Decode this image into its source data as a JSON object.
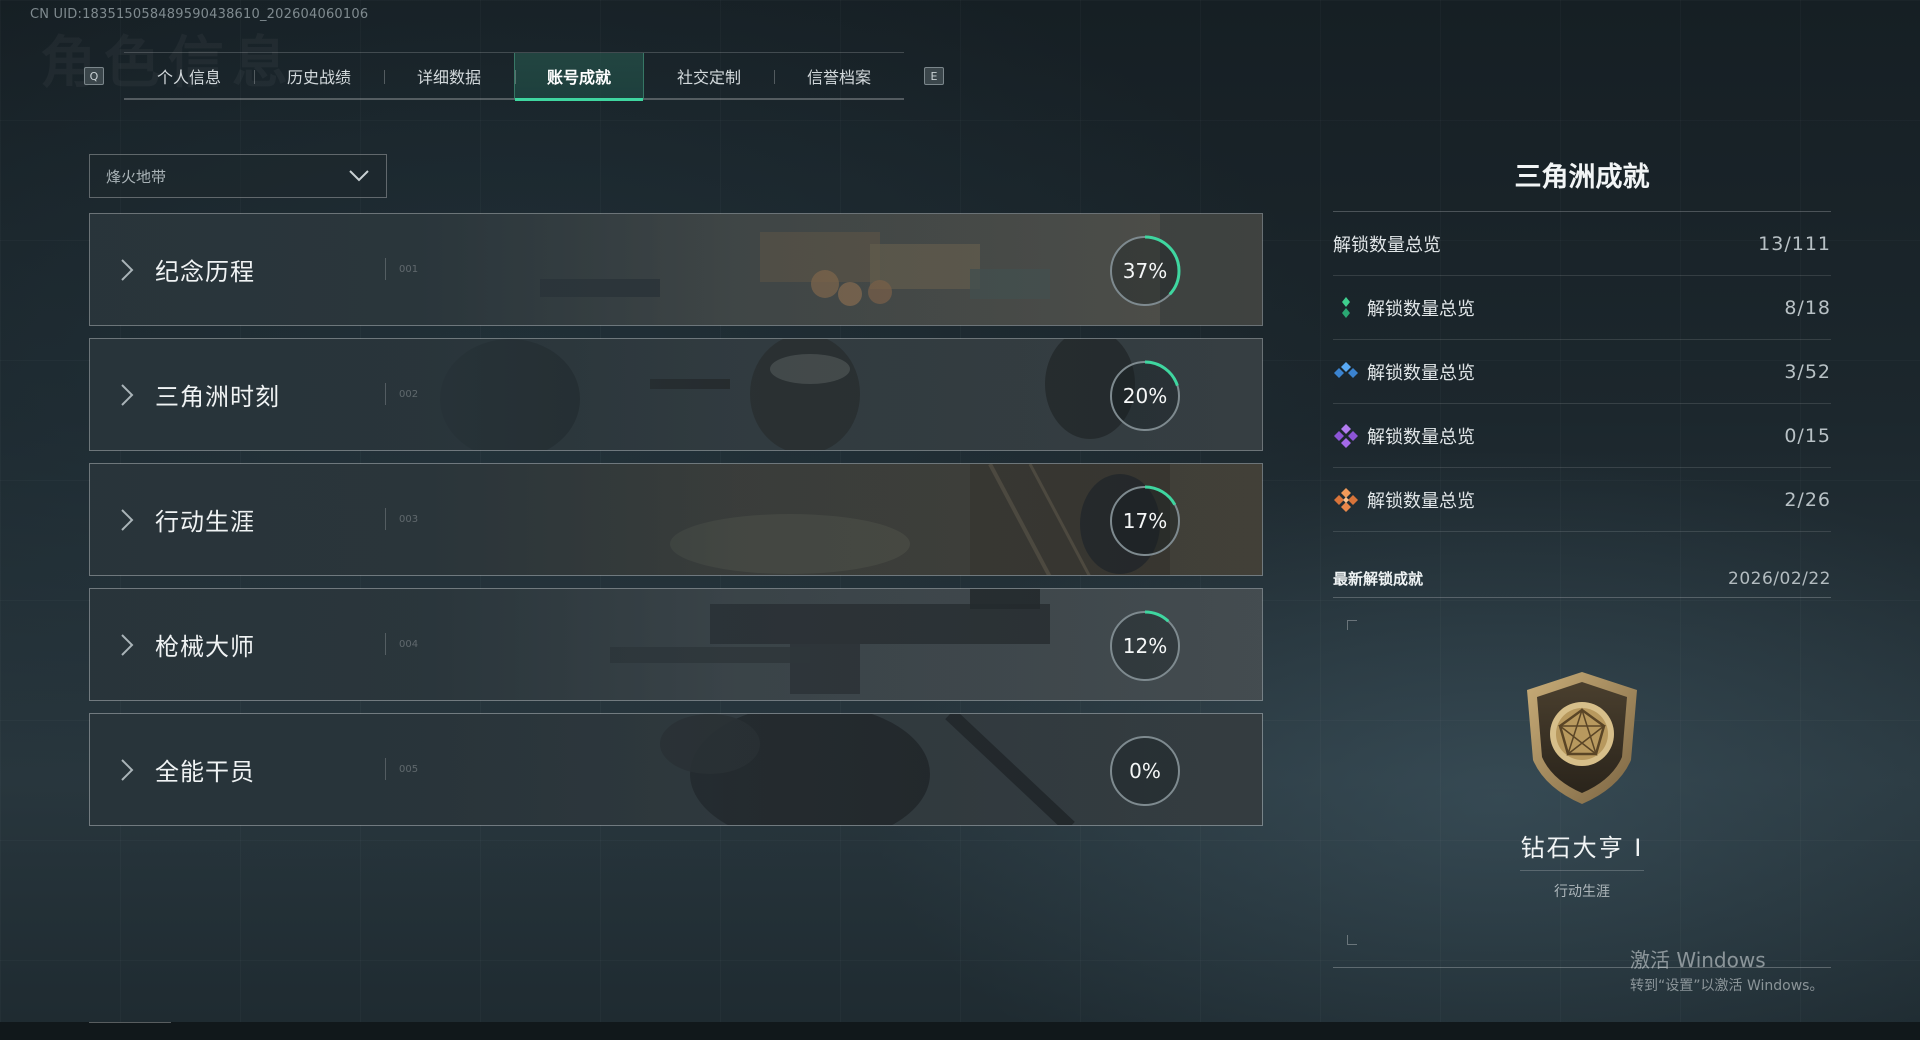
{
  "header": {
    "uid": "CN UID:1835150584895904386​10_202604060106",
    "tab_prev_key": "Q",
    "tab_next_key": "E",
    "tabs": [
      {
        "label": "个人信息",
        "active": false
      },
      {
        "label": "历史战绩",
        "active": false
      },
      {
        "label": "详细数据",
        "active": false
      },
      {
        "label": "账号成就",
        "active": true
      },
      {
        "label": "社交定制",
        "active": false
      },
      {
        "label": "信誉档案",
        "active": false
      }
    ]
  },
  "mode_select": {
    "value": "烽火地带"
  },
  "categories": [
    {
      "title": "纪念历程",
      "percent_label": "37%",
      "percent": 37,
      "index": "001"
    },
    {
      "title": "三角洲时刻",
      "percent_label": "20%",
      "percent": 20,
      "index": "002"
    },
    {
      "title": "行动生涯",
      "percent_label": "17%",
      "percent": 17,
      "index": "003"
    },
    {
      "title": "枪械大师",
      "percent_label": "12%",
      "percent": 12,
      "index": "004"
    },
    {
      "title": "全能干员",
      "percent_label": "0%",
      "percent": 0,
      "index": "005"
    }
  ],
  "summary": {
    "title": "三角洲成就",
    "total": {
      "label": "解锁数量总览",
      "value": "13/111"
    },
    "rows": [
      {
        "icon": "green-gem-icon",
        "color": "#3fcf8e",
        "label": "解锁数量总览",
        "value": "8/18"
      },
      {
        "icon": "blue-gem-icon",
        "color": "#4a9ff0",
        "label": "解锁数量总览",
        "value": "3/52"
      },
      {
        "icon": "purple-gem-icon",
        "color": "#a46ae8",
        "label": "解锁数量总览",
        "value": "0/15"
      },
      {
        "icon": "orange-gem-icon",
        "color": "#e8874a",
        "label": "解锁数量总览",
        "value": "2/26"
      }
    ]
  },
  "latest": {
    "heading": "最新解锁成就",
    "date": "2026/02/22",
    "achievement_name": "钻石大亨 I",
    "achievement_category": "行动生涯",
    "badge_icon": "diamond-shield-badge-icon"
  },
  "windows_watermark": {
    "line1": "激活 Windows",
    "line2": "转到“设置”以激活 Windows。"
  },
  "colors": {
    "accent": "#3fd6a0",
    "ring_track": "#7e8a8f"
  }
}
